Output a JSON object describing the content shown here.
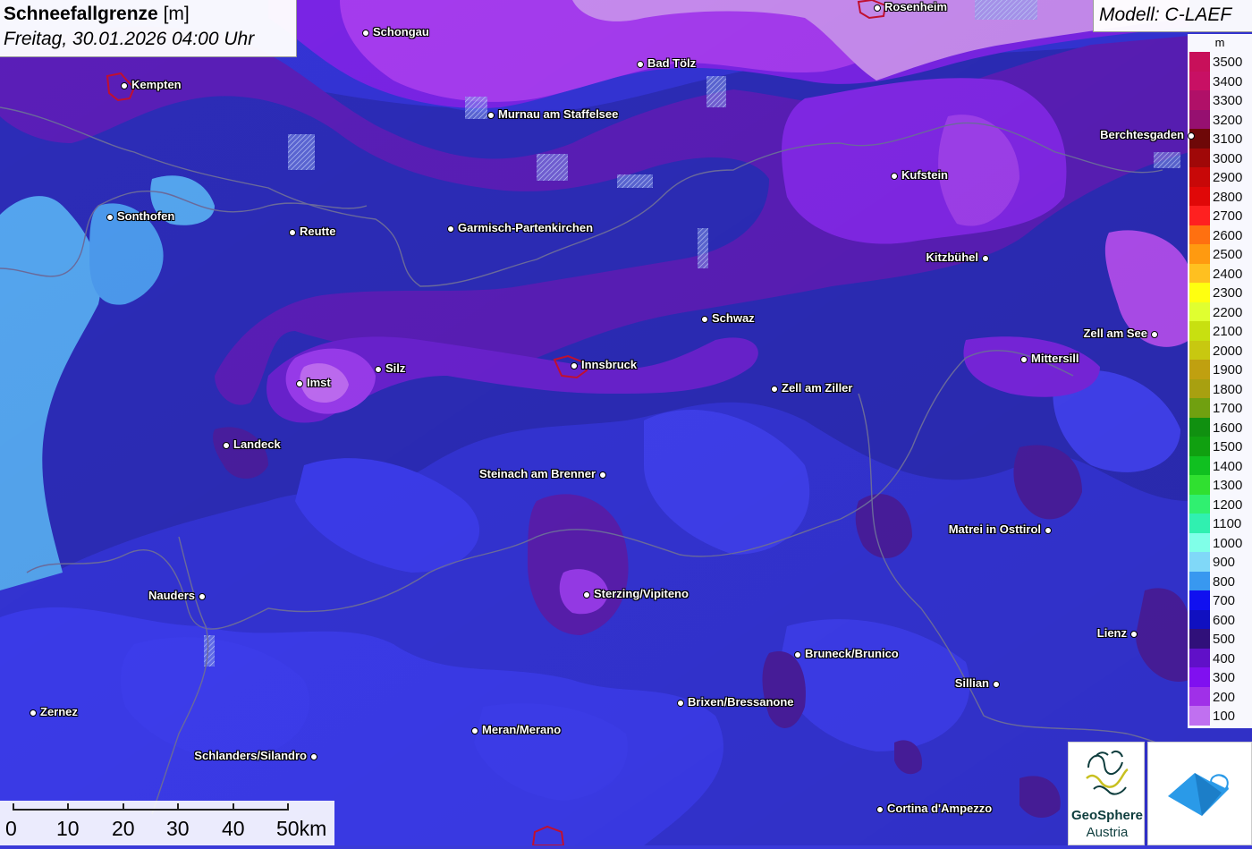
{
  "header": {
    "title_bold": "Schneefallgrenze",
    "title_unit": "[m]",
    "subtitle": "Freitag, 30.01.2026 04:00 Uhr"
  },
  "model": {
    "label": "Modell: C-LAEF"
  },
  "legend": {
    "unit": "m",
    "entries": [
      {
        "label": "3500",
        "color": "#c8105a"
      },
      {
        "label": "3400",
        "color": "#c81064"
      },
      {
        "label": "3300",
        "color": "#b01068"
      },
      {
        "label": "3200",
        "color": "#961070"
      },
      {
        "label": "3100",
        "color": "#6e0808"
      },
      {
        "label": "3000",
        "color": "#a00808"
      },
      {
        "label": "2900",
        "color": "#c80808"
      },
      {
        "label": "2800",
        "color": "#e00808"
      },
      {
        "label": "2700",
        "color": "#ff2020"
      },
      {
        "label": "2600",
        "color": "#ff7010"
      },
      {
        "label": "2500",
        "color": "#ff9a10"
      },
      {
        "label": "2400",
        "color": "#ffc020"
      },
      {
        "label": "2300",
        "color": "#ffff10"
      },
      {
        "label": "2200",
        "color": "#e0ff30"
      },
      {
        "label": "2100",
        "color": "#c8e010"
      },
      {
        "label": "2000",
        "color": "#c8c810"
      },
      {
        "label": "1900",
        "color": "#c0a010"
      },
      {
        "label": "1800",
        "color": "#a8a010"
      },
      {
        "label": "1700",
        "color": "#70a010"
      },
      {
        "label": "1600",
        "color": "#109010"
      },
      {
        "label": "1500",
        "color": "#10a010"
      },
      {
        "label": "1400",
        "color": "#10c020"
      },
      {
        "label": "1300",
        "color": "#30e030"
      },
      {
        "label": "1200",
        "color": "#30f070"
      },
      {
        "label": "1100",
        "color": "#30f0b0"
      },
      {
        "label": "1000",
        "color": "#80ffe8"
      },
      {
        "label": "900",
        "color": "#80d8f8"
      },
      {
        "label": "800",
        "color": "#3898f0"
      },
      {
        "label": "700",
        "color": "#1010f0"
      },
      {
        "label": "600",
        "color": "#1010c0"
      },
      {
        "label": "500",
        "color": "#30107a"
      },
      {
        "label": "400",
        "color": "#6010c8"
      },
      {
        "label": "300",
        "color": "#8010f0"
      },
      {
        "label": "200",
        "color": "#a030e8"
      },
      {
        "label": "100",
        "color": "#c070f0"
      }
    ]
  },
  "cities": [
    {
      "name": "Rosenheim",
      "side": "right"
    },
    {
      "name": "Schongau",
      "side": "right"
    },
    {
      "name": "Bad Tölz",
      "side": "right"
    },
    {
      "name": "Kempten",
      "side": "right"
    },
    {
      "name": "Murnau am Staffelsee",
      "side": "right"
    },
    {
      "name": "Berchtesgaden",
      "side": "left"
    },
    {
      "name": "Kufstein",
      "side": "right"
    },
    {
      "name": "Sonthofen",
      "side": "right"
    },
    {
      "name": "Reutte",
      "side": "right"
    },
    {
      "name": "Garmisch-Partenkirchen",
      "side": "right"
    },
    {
      "name": "Kitzbühel",
      "side": "left"
    },
    {
      "name": "Schwaz",
      "side": "right"
    },
    {
      "name": "Zell am See",
      "side": "left"
    },
    {
      "name": "Imst",
      "side": "right"
    },
    {
      "name": "Silz",
      "side": "right"
    },
    {
      "name": "Innsbruck",
      "side": "right"
    },
    {
      "name": "Mittersill",
      "side": "right"
    },
    {
      "name": "Zell am Ziller",
      "side": "right"
    },
    {
      "name": "Landeck",
      "side": "right"
    },
    {
      "name": "Steinach am Brenner",
      "side": "left"
    },
    {
      "name": "Matrei in Osttirol",
      "side": "left"
    },
    {
      "name": "Nauders",
      "side": "left"
    },
    {
      "name": "Sterzing/Vipiteno",
      "side": "right"
    },
    {
      "name": "Lienz",
      "side": "left"
    },
    {
      "name": "Bruneck/Brunico",
      "side": "right"
    },
    {
      "name": "Sillian",
      "side": "left"
    },
    {
      "name": "Brixen/Bressanone",
      "side": "right"
    },
    {
      "name": "Zernez",
      "side": "right"
    },
    {
      "name": "Meran/Merano",
      "side": "right"
    },
    {
      "name": "Schlanders/Silandro",
      "side": "left"
    },
    {
      "name": "Cortina d'Ampezzo",
      "side": "right"
    }
  ],
  "scale": {
    "labels": [
      "0",
      "10",
      "20",
      "30",
      "40",
      "50km"
    ]
  },
  "logos": {
    "geosphere_line1": "GeoSphere",
    "geosphere_line2": "Austria"
  }
}
